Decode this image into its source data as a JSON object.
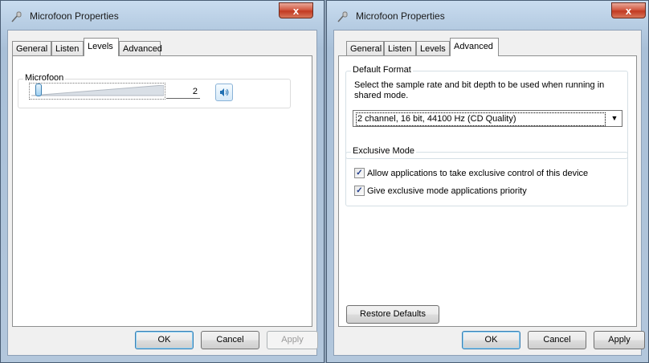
{
  "left_window": {
    "title": "Microfoon Properties",
    "close_label": "x",
    "tabs": [
      {
        "label": "General"
      },
      {
        "label": "Listen"
      },
      {
        "label": "Levels",
        "active": true
      },
      {
        "label": "Advanced"
      }
    ],
    "levels": {
      "group_label": "Microfoon",
      "level_value": "2",
      "level_fraction": 0.02,
      "speaker_icon": "speaker-icon"
    },
    "buttons": {
      "ok": "OK",
      "cancel": "Cancel",
      "apply": "Apply"
    }
  },
  "right_window": {
    "title": "Microfoon Properties",
    "close_label": "x",
    "tabs": [
      {
        "label": "General"
      },
      {
        "label": "Listen"
      },
      {
        "label": "Levels"
      },
      {
        "label": "Advanced",
        "active": true
      }
    ],
    "default_format": {
      "group_label": "Default Format",
      "description": "Select the sample rate and bit depth to be used when running in shared mode.",
      "selected": "2 channel, 16 bit, 44100 Hz (CD Quality)"
    },
    "exclusive_mode": {
      "group_label": "Exclusive Mode",
      "options": [
        {
          "label": "Allow applications to take exclusive control of this device",
          "checked": true
        },
        {
          "label": "Give exclusive mode applications priority",
          "checked": true
        }
      ]
    },
    "restore_defaults": "Restore Defaults",
    "buttons": {
      "ok": "OK",
      "cancel": "Cancel",
      "apply": "Apply"
    }
  },
  "colors": {
    "accent": "#3c7fb1",
    "close": "#c23a22",
    "checkmark": "#1e3a8a"
  }
}
